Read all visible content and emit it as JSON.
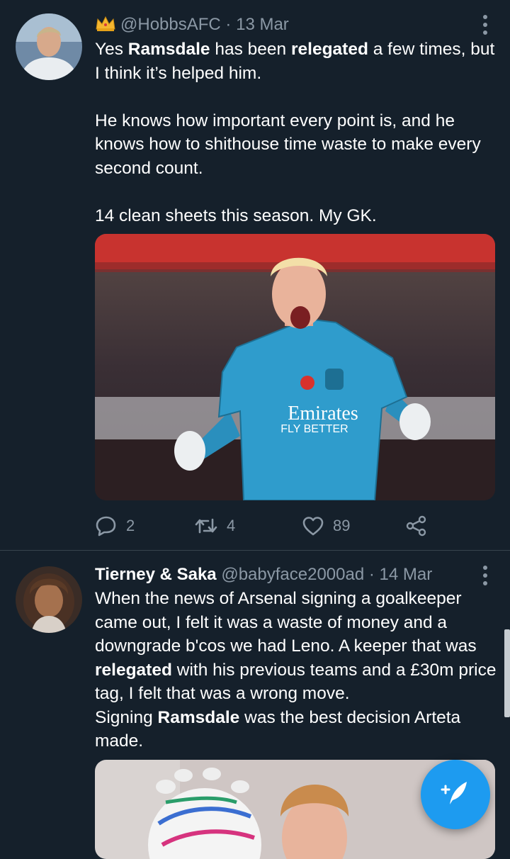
{
  "colors": {
    "background": "#15202b",
    "divider": "#38444d",
    "secondary_text": "#8b98a5",
    "accent": "#1d9bf0"
  },
  "tweets": [
    {
      "handle": "@HobbsAFC",
      "separator": "·",
      "date": "13 Mar",
      "badge_icon": "crown-icon",
      "body": {
        "line1_a": "Yes ",
        "line1_b": "Ramsdale",
        "line1_c": " has been ",
        "line1_d": "relegated",
        "line1_e": " a few times, but I think it’s helped him.",
        "para2": "He knows how important every point is, and he knows how to shithouse time waste to make every second count.",
        "para3": "14 clean sheets this season. My GK."
      },
      "media_text": {
        "sponsor": "Emirates",
        "slogan": "FLY BETTER"
      },
      "actions": {
        "replies": "2",
        "retweets": "4",
        "likes": "89"
      }
    },
    {
      "display_name": "Tierney & Saka",
      "handle": "@babyface2000ad",
      "separator": "·",
      "date": "14 Mar",
      "body": {
        "t1": "When the news of Arsenal signing a goalkeeper came out, I felt it was a waste of money and a downgrade b'cos we had Leno. A keeper that was ",
        "t2": "relegated",
        "t3": " with his previous teams and a £30m price tag, I felt that was a wrong move.",
        "t4": "Signing ",
        "t5": "Ramsdale",
        "t6": " was the best decision Arteta made."
      }
    }
  ],
  "compose_button": {
    "icon": "compose-feather-icon"
  }
}
